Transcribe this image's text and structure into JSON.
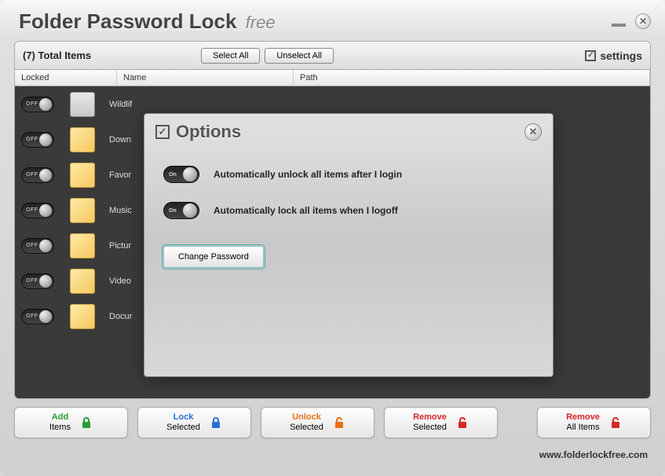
{
  "app": {
    "title": "Folder Password Lock",
    "edition": "free"
  },
  "toolbar": {
    "total_items": "(7) Total Items",
    "select_all": "Select All",
    "unselect_all": "Unselect All",
    "settings": "settings"
  },
  "columns": {
    "locked": "Locked",
    "name": "Name",
    "path": "Path"
  },
  "rows": [
    {
      "name": "Wildlif",
      "icon": "wmv",
      "toggle": "OFF"
    },
    {
      "name": "Down",
      "icon": "folder",
      "toggle": "OFF"
    },
    {
      "name": "Favor",
      "icon": "folder",
      "toggle": "OFF"
    },
    {
      "name": "Music",
      "icon": "folder",
      "toggle": "OFF"
    },
    {
      "name": "Pictur",
      "icon": "folder",
      "toggle": "OFF"
    },
    {
      "name": "Video",
      "icon": "folder",
      "toggle": "OFF"
    },
    {
      "name": "Docur",
      "icon": "folder",
      "toggle": "OFF"
    }
  ],
  "actions": {
    "add": {
      "primary": "Add",
      "secondary": "Items"
    },
    "lock": {
      "primary": "Lock",
      "secondary": "Selected"
    },
    "unlock": {
      "primary": "Unlock",
      "secondary": "Selected"
    },
    "remove": {
      "primary": "Remove",
      "secondary": "Selected"
    },
    "removeall": {
      "primary": "Remove",
      "secondary": "All Items"
    }
  },
  "footer": {
    "url": "www.folderlockfree.com"
  },
  "dialog": {
    "title": "Options",
    "opt1": "Automatically unlock all items after I login",
    "opt2": "Automatically lock all items when I logoff",
    "change_pw": "Change Password",
    "toggle1": "On",
    "toggle2": "On"
  }
}
